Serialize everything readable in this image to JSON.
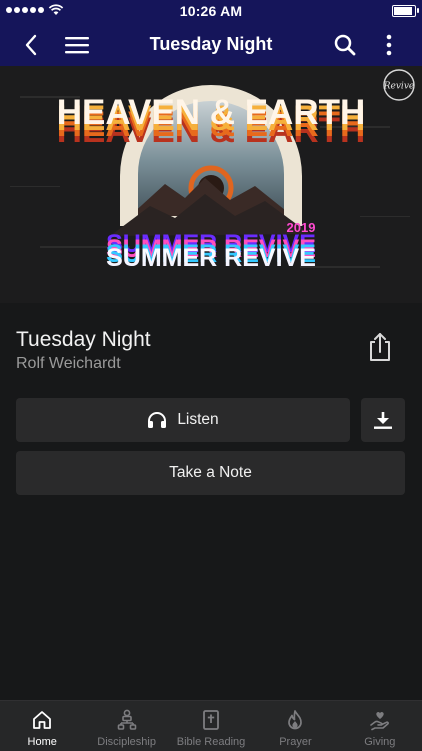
{
  "status_bar": {
    "time": "10:26 AM",
    "battery_level": 0.95
  },
  "nav": {
    "title": "Tuesday Night",
    "back_icon": "chevron-left-icon",
    "menu_icon": "hamburger-icon",
    "search_icon": "search-icon",
    "more_icon": "more-vertical-icon"
  },
  "artwork": {
    "headline": "HEAVEN & EARTH",
    "year": "2019",
    "subtitle": "SUMMER REVIVE",
    "logo_text": "Revive"
  },
  "sermon": {
    "title": "Tuesday Night",
    "speaker": "Rolf Weichardt"
  },
  "actions": {
    "listen_label": "Listen",
    "note_label": "Take a Note"
  },
  "tabs": [
    {
      "label": "Home",
      "icon": "home-icon",
      "active": true
    },
    {
      "label": "Discipleship",
      "icon": "discipleship-icon",
      "active": false
    },
    {
      "label": "Bible Reading",
      "icon": "bible-icon",
      "active": false
    },
    {
      "label": "Prayer",
      "icon": "flame-icon",
      "active": false
    },
    {
      "label": "Giving",
      "icon": "giving-hand-icon",
      "active": false
    }
  ],
  "colors": {
    "nav_bg": "#15155a",
    "page_bg": "#171819",
    "button_bg": "#2a2a2b",
    "tab_bg": "#262728"
  }
}
